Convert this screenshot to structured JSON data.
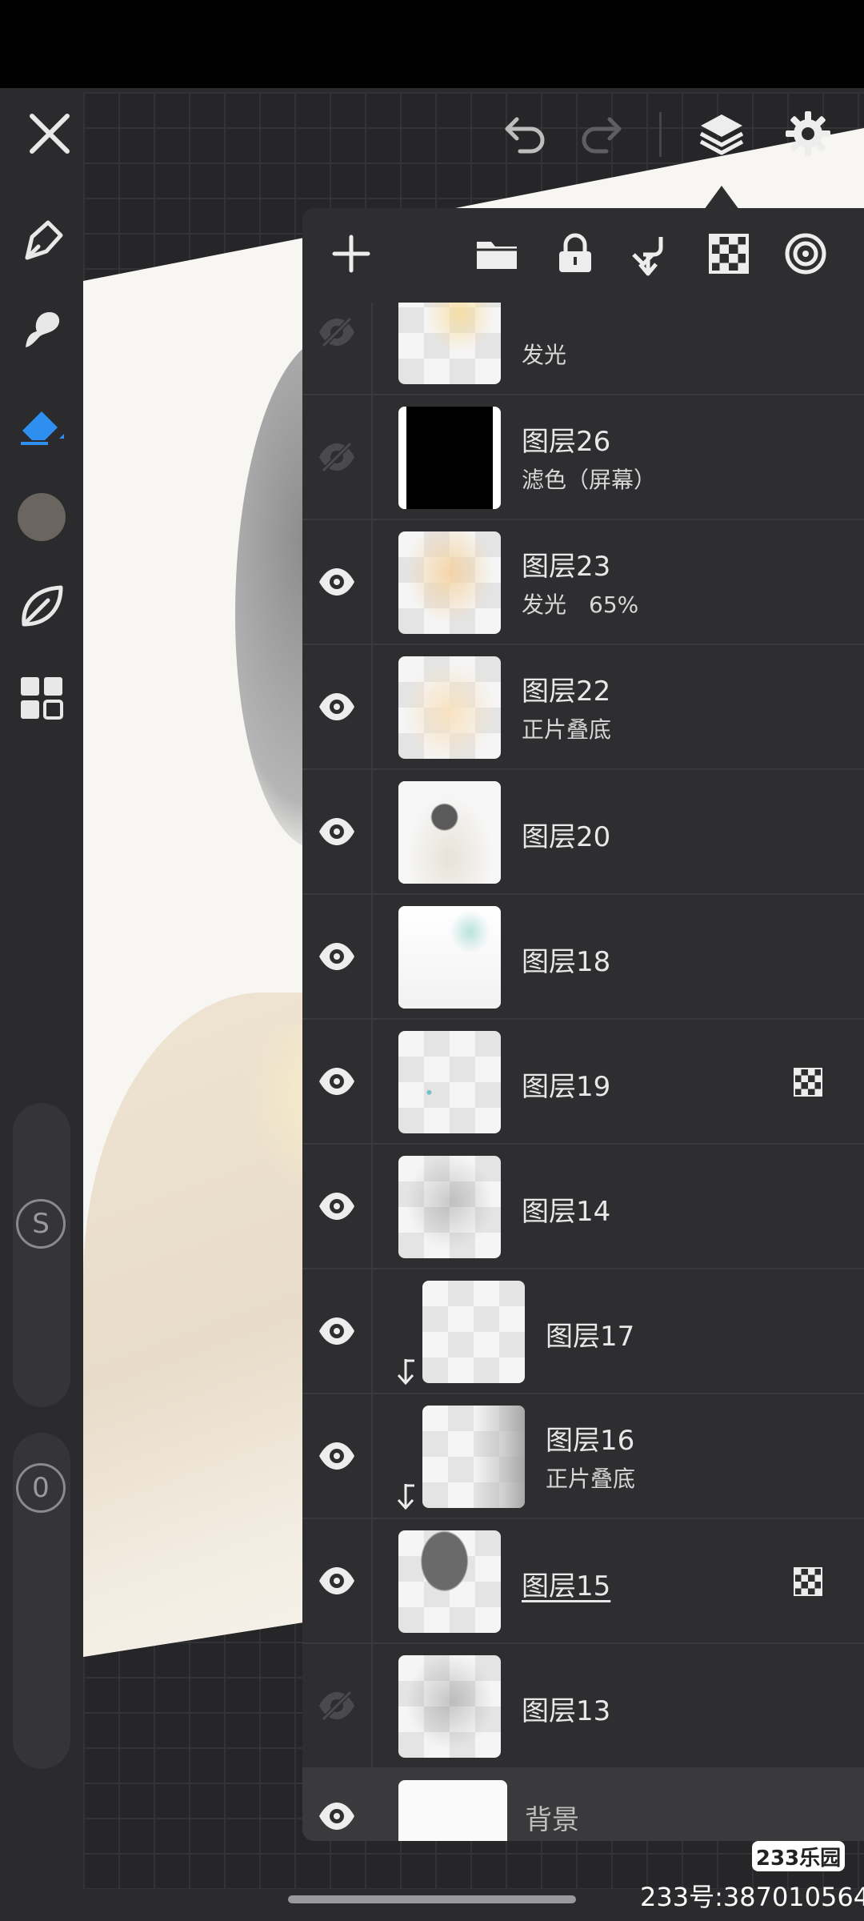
{
  "toolbar": {
    "close_icon": "close-icon",
    "undo_icon": "undo-icon",
    "redo_icon": "redo-icon",
    "layers_icon": "layers-icon",
    "settings_icon": "gear-icon"
  },
  "side_tools": {
    "items": [
      "pen-icon",
      "smudge-icon",
      "eraser-icon",
      "color-swatch",
      "blend-leaf-icon",
      "grid-menu-icon"
    ],
    "active": "eraser-icon",
    "colors": {
      "active": "#2f8ff0",
      "swatch": "#6b6560"
    },
    "size_badge": "S",
    "opacity_badge": "0"
  },
  "layer_panel": {
    "tools": [
      "add-layer-icon",
      "folder-icon",
      "lock-icon",
      "merge-down-icon",
      "checker-icon",
      "more-icon"
    ],
    "layers": [
      {
        "name": "",
        "mode": "发光",
        "visible": false
      },
      {
        "name": "图层26",
        "mode": "滤色（屏幕）",
        "visible": false
      },
      {
        "name": "图层23",
        "mode": "发光　65%",
        "visible": true
      },
      {
        "name": "图层22",
        "mode": "正片叠底",
        "visible": true
      },
      {
        "name": "图层20",
        "mode": "",
        "visible": true
      },
      {
        "name": "图层18",
        "mode": "",
        "visible": true
      },
      {
        "name": "图层19",
        "mode": "",
        "visible": true,
        "alpha_lock": true
      },
      {
        "name": "图层14",
        "mode": "",
        "visible": true
      },
      {
        "name": "图层17",
        "mode": "",
        "visible": true,
        "clipped": true
      },
      {
        "name": "图层16",
        "mode": "正片叠底",
        "visible": true,
        "clipped": true
      },
      {
        "name": "图层15",
        "mode": "",
        "visible": true,
        "alpha_lock": true,
        "selected": true
      },
      {
        "name": "图层13",
        "mode": "",
        "visible": false
      }
    ],
    "background": {
      "name": "背景",
      "visible": true
    }
  },
  "watermark": {
    "badge": "233乐园",
    "text": "233号:387010564"
  }
}
